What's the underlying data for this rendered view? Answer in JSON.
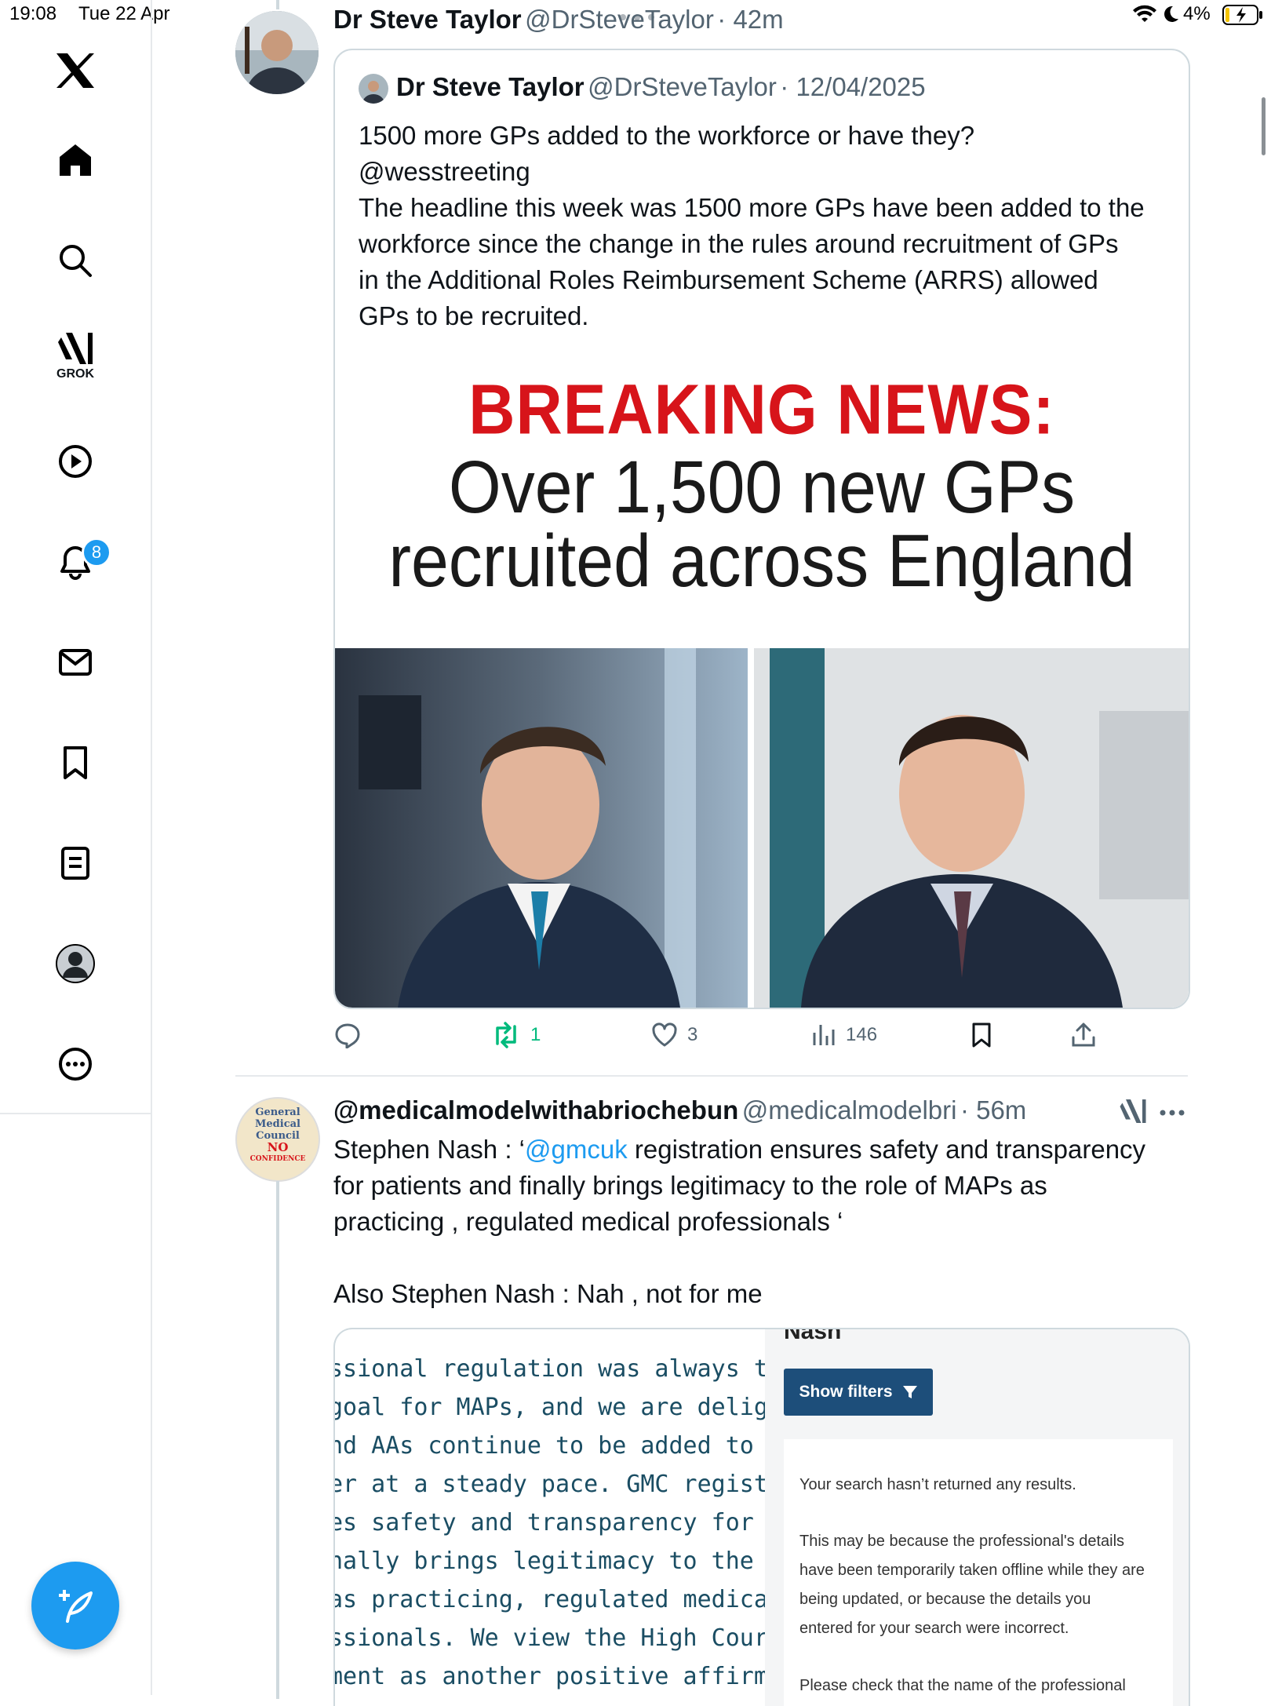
{
  "status_bar": {
    "time": "19:08",
    "date": "Tue 22 Apr",
    "battery": "4%"
  },
  "sidebar": {
    "items": [
      {
        "name": "home",
        "label": ""
      },
      {
        "name": "explore",
        "label": ""
      },
      {
        "name": "grok",
        "label": "GROK"
      },
      {
        "name": "video",
        "label": ""
      },
      {
        "name": "notifications",
        "label": "",
        "badge": "8"
      },
      {
        "name": "messages",
        "label": ""
      },
      {
        "name": "bookmarks",
        "label": ""
      },
      {
        "name": "lists",
        "label": ""
      },
      {
        "name": "profile",
        "label": ""
      },
      {
        "name": "more",
        "label": ""
      }
    ]
  },
  "tweet1": {
    "name": "Dr Steve Taylor",
    "handle": "@DrSteveTaylor",
    "time": "· 42m",
    "quote": {
      "name": "Dr Steve Taylor",
      "handle": "@DrSteveTaylor",
      "date": "· 12/04/2025",
      "lines": [
        "1500 more GPs added to the workforce or have they?",
        "@wesstreeting",
        "The headline this week was 1500 more GPs have been added to the",
        "workforce since the change in the rules around recruitment of GPs",
        "in the Additional Roles Reimbursement Scheme (ARRS) allowed",
        "GPs to be recruited."
      ],
      "image": {
        "headline": "BREAKING NEWS:",
        "line1": "Over 1,500 new GPs",
        "line2": "recruited across England"
      }
    },
    "actions": {
      "reply": "",
      "retweets": "1",
      "likes": "3",
      "views": "146"
    }
  },
  "tweet2": {
    "name": "@medicalmodelwithabriochebun",
    "handle": "@medicalmodelbri",
    "time": "· 56m",
    "avatar_text": [
      "General",
      "Medical",
      "Council",
      "NO",
      "CONFIDENCE"
    ],
    "text_prefix": "Stephen Nash : ‘",
    "mention": "@gmcuk",
    "text_rest": " registration ensures safety and transparency",
    "lines": [
      "for patients and finally brings legitimacy to the role of MAPs as",
      "practicing , regulated medical professionals ‘",
      "",
      "Also Stephen Nash : Nah , not for me"
    ],
    "image": {
      "left_lines": [
        "ssional regulation was always the lor",
        "goal for MAPs, and we are delighted",
        "nd AAs continue to be added to the",
        "er at a steady pace. GMC registratior",
        "es safety and transparency for patie",
        "nally brings legitimacy to the role of",
        " as practicing, regulated medical",
        "ssionals. We view the High Court's",
        "ment as another positive affirmation"
      ],
      "right_header": "Nash",
      "filter_button": "Show filters",
      "result_line": "Your search hasn’t returned any results.",
      "explain_lines": [
        "This may be because the professional's details",
        "have been temporarily taken offline while they are",
        "being updated, or because the details you",
        "entered for your search were incorrect."
      ],
      "last_line": "Please check that the name of the professional"
    }
  },
  "colors": {
    "accent": "#1d9bf0",
    "retweet": "#00ba7c",
    "breaking": "#d7141a"
  }
}
